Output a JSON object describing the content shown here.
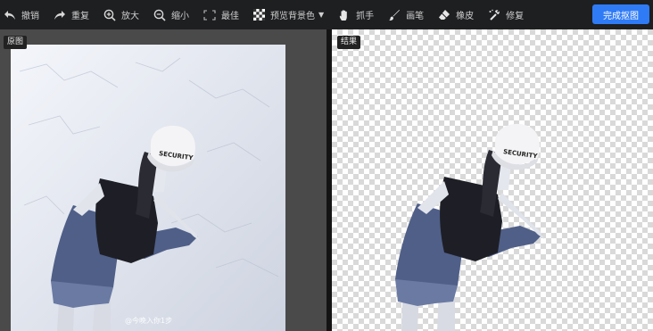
{
  "toolbar": {
    "undo_label": "撤销",
    "redo_label": "重复",
    "zoom_in_label": "放大",
    "zoom_out_label": "缩小",
    "best_fit_label": "最佳",
    "preview_bg_label": "预览背景色",
    "grab_label": "抓手",
    "brush_label": "画笔",
    "eraser_label": "橡皮",
    "repair_label": "修复",
    "finish_label": "完成抠图"
  },
  "left_panel": {
    "badge": "原图",
    "watermark": "@今晚入你1步"
  },
  "right_panel": {
    "badge": "结果"
  },
  "colors": {
    "accent": "#2f7bf5",
    "toolbar_bg": "#1e1f21",
    "left_bg": "#4a4a4b"
  },
  "icons": [
    "undo-icon",
    "redo-icon",
    "zoom-in-icon",
    "zoom-out-icon",
    "fit-icon",
    "checker-icon",
    "hand-icon",
    "brush-icon",
    "eraser-icon",
    "repair-icon"
  ]
}
